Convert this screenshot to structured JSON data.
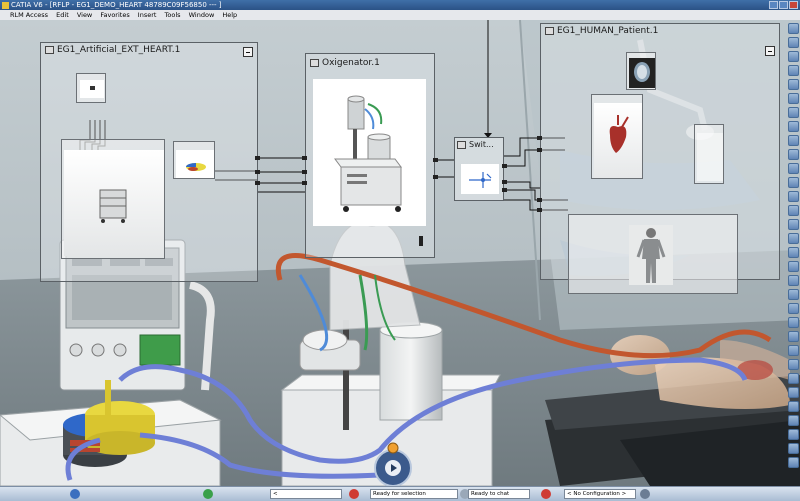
{
  "app": {
    "title": "CATIA V6 - [RFLP - EG1_DEMO_HEART 48789C09F56850 --- ]",
    "menu": [
      "RLM Access",
      "Edit",
      "View",
      "Favorites",
      "Insert",
      "Tools",
      "Window",
      "Help"
    ]
  },
  "windows": {
    "artificial_heart": {
      "title": "EG1_Artificial_EXT_HEART.1"
    },
    "oxigenator": {
      "title": "Oxigenator.1"
    },
    "switch": {
      "title": "Swit..."
    },
    "human_patient": {
      "title": "EG1_HUMAN_Patient.1"
    }
  },
  "statusbar": {
    "command_prompt": "<",
    "selection_status": "Ready for selection",
    "chat_status": "Ready to chat",
    "configuration": "< No Configuration >"
  },
  "colors": {
    "title_bar": "#2b5286",
    "tube_blue": "#6e7fd6",
    "tube_orange": "#c2572e",
    "tube_green": "#3a9b53",
    "pump_yellow": "#e8d840",
    "pump_blue": "#2f68c9"
  },
  "icons": {
    "app_logo": "catia-logo-icon",
    "compass": "compass-navigation-icon",
    "window_minimize": "minimize-icon"
  }
}
